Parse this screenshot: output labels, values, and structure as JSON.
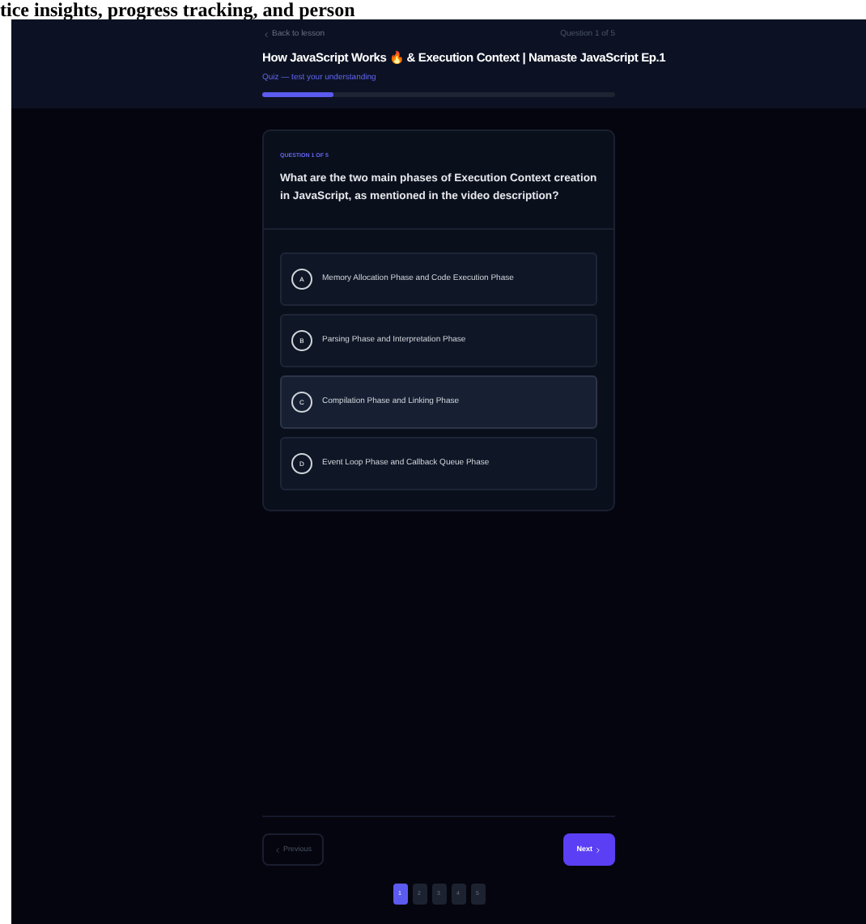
{
  "banner_text": "tice insights, progress tracking, and person",
  "header": {
    "back_link": "Back to lesson",
    "counter": "Question 1 of 5",
    "title": "How JavaScript Works 🔥 & Execution Context | Namaste JavaScript Ep.1",
    "subtitle": "Quiz — test your understanding",
    "progress": {
      "level": 0.2
    }
  },
  "question": {
    "label": "QUESTION 1 OF 5",
    "text": "What are the two main phases of Execution Context creation in JavaScript, as mentioned in the video description?",
    "options": [
      {
        "letter": "A",
        "text": "Memory Allocation Phase and Code Execution Phase",
        "highlighted": false
      },
      {
        "letter": "B",
        "text": "Parsing Phase and Interpretation Phase",
        "highlighted": false
      },
      {
        "letter": "C",
        "text": "Compilation Phase and Linking Phase",
        "highlighted": true
      },
      {
        "letter": "D",
        "text": "Event Loop Phase and Callback Queue Phase",
        "highlighted": false
      }
    ]
  },
  "footer": {
    "previous": {
      "label": "Previous",
      "disabled": true
    },
    "next": {
      "label": "Next",
      "disabled": false
    },
    "pages": [
      {
        "label": "1",
        "selected": true
      },
      {
        "label": "2",
        "selected": false
      },
      {
        "label": "3",
        "selected": false
      },
      {
        "label": "4",
        "selected": false
      },
      {
        "label": "5",
        "selected": false
      }
    ]
  }
}
